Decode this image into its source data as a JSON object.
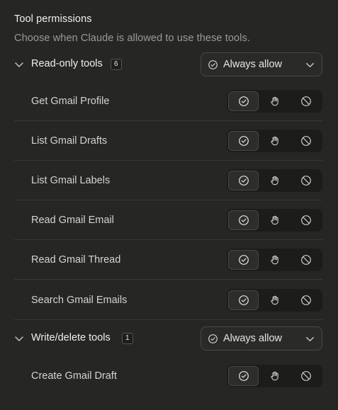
{
  "title": "Tool permissions",
  "subtitle": "Choose when Claude is allowed to use these tools.",
  "groups": [
    {
      "name": "Read-only tools",
      "count": "6",
      "policy": "Always allow",
      "tools": [
        {
          "name": "Get Gmail Profile",
          "selected": "allow"
        },
        {
          "name": "List Gmail Drafts",
          "selected": "allow"
        },
        {
          "name": "List Gmail Labels",
          "selected": "allow"
        },
        {
          "name": "Read Gmail Email",
          "selected": "allow"
        },
        {
          "name": "Read Gmail Thread",
          "selected": "allow"
        },
        {
          "name": "Search Gmail Emails",
          "selected": "allow"
        }
      ]
    },
    {
      "name": "Write/delete tools",
      "count": "1",
      "policy": "Always allow",
      "tools": [
        {
          "name": "Create Gmail Draft",
          "selected": "allow"
        }
      ]
    }
  ],
  "icons": {
    "group_toggle": "chevron-down-icon",
    "policy": "check-circle-icon",
    "dropdown": "chevron-down-icon",
    "options": [
      "check-circle-icon",
      "hand-icon",
      "block-icon"
    ]
  },
  "colors": {
    "background": "#262624",
    "segment_bg": "#1c1c1b",
    "segment_active": "#2d2d2b",
    "border": "#4a4844",
    "text_primary": "#f2f0eb",
    "text_muted": "#9c9a93"
  }
}
